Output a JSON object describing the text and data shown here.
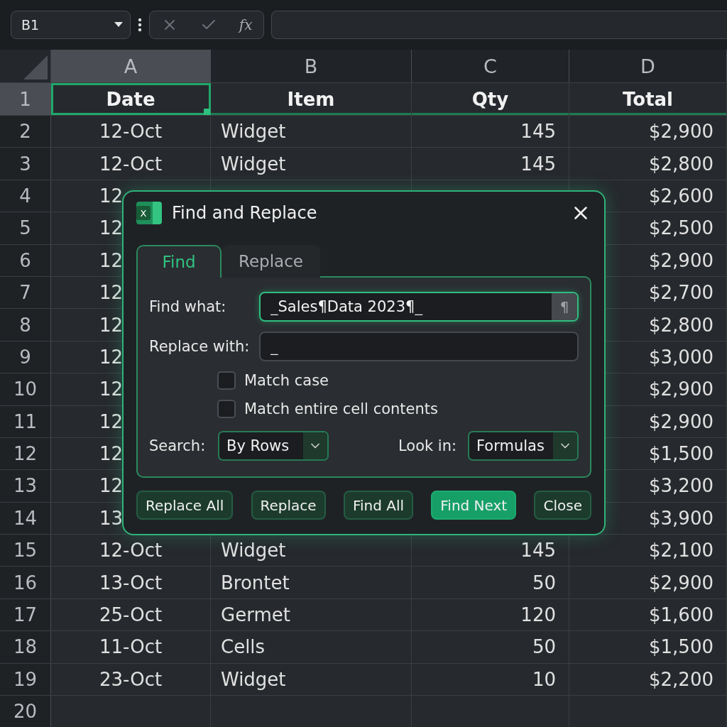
{
  "formula_bar": {
    "name_box": "B1",
    "function_label": "fx"
  },
  "columns": [
    {
      "label": "A",
      "selected": true
    },
    {
      "label": "B",
      "selected": false
    },
    {
      "label": "C",
      "selected": false
    },
    {
      "label": "D",
      "selected": false
    }
  ],
  "rows": [
    {
      "number": "1",
      "selected": true,
      "header": true,
      "cells": [
        "Date",
        "Item",
        "Qty",
        "Total"
      ]
    },
    {
      "number": "2",
      "selected": false,
      "cells": [
        "12-Oct",
        "Widget",
        "145",
        "$2,900"
      ]
    },
    {
      "number": "3",
      "selected": false,
      "cells": [
        "12-Oct",
        "Widget",
        "145",
        "$2,800"
      ]
    },
    {
      "number": "4",
      "selected": false,
      "cells": [
        "12",
        "",
        "",
        "$2,600"
      ]
    },
    {
      "number": "5",
      "selected": false,
      "cells": [
        "12",
        "",
        "",
        "$2,500"
      ]
    },
    {
      "number": "6",
      "selected": false,
      "cells": [
        "12",
        "",
        "",
        "$2,900"
      ]
    },
    {
      "number": "7",
      "selected": false,
      "cells": [
        "12",
        "",
        "",
        "$2,700"
      ]
    },
    {
      "number": "8",
      "selected": false,
      "cells": [
        "12",
        "",
        "",
        "$2,800"
      ]
    },
    {
      "number": "9",
      "selected": false,
      "cells": [
        "12",
        "",
        "",
        "$3,000"
      ]
    },
    {
      "number": "10",
      "selected": false,
      "cells": [
        "12",
        "",
        "",
        "$2,900"
      ]
    },
    {
      "number": "11",
      "selected": false,
      "cells": [
        "12",
        "",
        "",
        "$2,900"
      ]
    },
    {
      "number": "12",
      "selected": false,
      "cells": [
        "12",
        "",
        "",
        "$1,500"
      ]
    },
    {
      "number": "13",
      "selected": false,
      "cells": [
        "12",
        "",
        "",
        "$3,200"
      ]
    },
    {
      "number": "14",
      "selected": false,
      "cells": [
        "13",
        "",
        "",
        "$3,900"
      ]
    },
    {
      "number": "15",
      "selected": false,
      "cells": [
        "12-Oct",
        "Widget",
        "145",
        "$2,100"
      ]
    },
    {
      "number": "16",
      "selected": false,
      "cells": [
        "13-Oct",
        "Brontet",
        "50",
        "$2,900"
      ]
    },
    {
      "number": "17",
      "selected": false,
      "cells": [
        "25-Oct",
        "Germet",
        "120",
        "$1,600"
      ]
    },
    {
      "number": "18",
      "selected": false,
      "cells": [
        "11-Oct",
        "Cells",
        "50",
        "$1,500"
      ]
    },
    {
      "number": "19",
      "selected": false,
      "cells": [
        "23-Oct",
        "Widget",
        "10",
        "$2,200"
      ]
    },
    {
      "number": "20",
      "selected": false,
      "cells": [
        "",
        "",
        "",
        ""
      ]
    }
  ],
  "dialog": {
    "app_icon_letter": "X",
    "title": "Find and Replace",
    "tabs": [
      {
        "label": "Find",
        "selected": true
      },
      {
        "label": "Replace",
        "selected": false
      }
    ],
    "find_what": {
      "label": "Find what:",
      "value": "_Sales¶Data 2023¶_",
      "special_button": "¶"
    },
    "replace_with": {
      "label": "Replace with:",
      "value": "_"
    },
    "options": [
      {
        "label": "Match case",
        "checked": false
      },
      {
        "label": "Match entire cell contents",
        "checked": false
      }
    ],
    "search": {
      "label": "Search:",
      "value": "By Rows"
    },
    "look_in": {
      "label": "Look in:",
      "value": "Formulas"
    },
    "buttons": [
      {
        "label": "Replace All",
        "primary": false
      },
      {
        "label": "Replace",
        "primary": false
      },
      {
        "label": "Find All",
        "primary": false
      },
      {
        "label": "Find Next",
        "primary": true
      },
      {
        "label": "Close",
        "primary": false
      }
    ]
  }
}
